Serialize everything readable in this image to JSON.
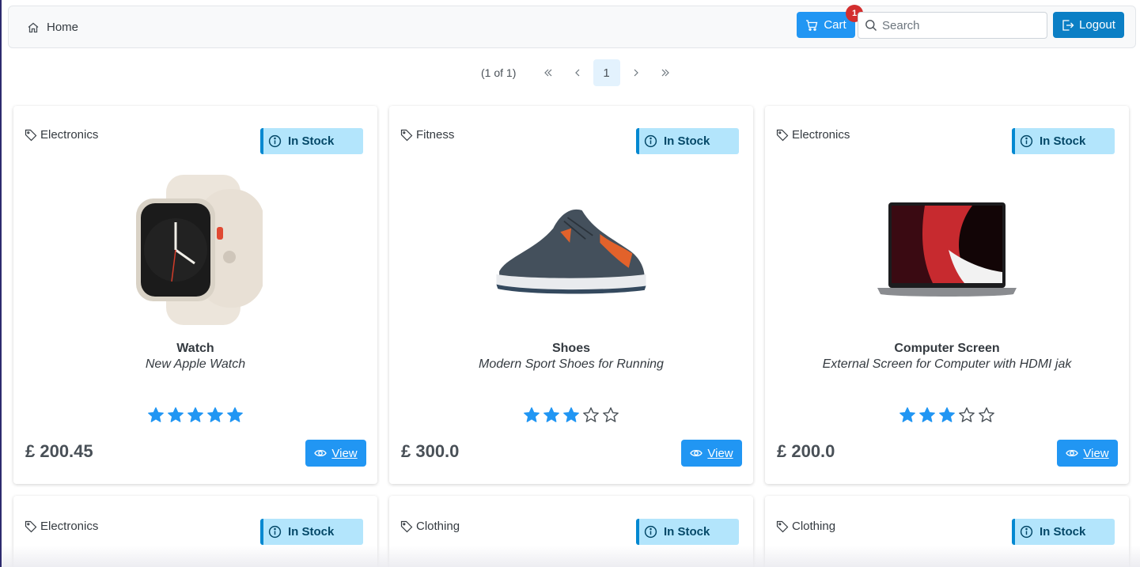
{
  "header": {
    "home_label": "Home",
    "cart_label": "Cart",
    "cart_count": "1",
    "search_placeholder": "Search",
    "logout_label": "Logout"
  },
  "paginator": {
    "report": "(1 of 1)",
    "current_page": "1"
  },
  "colors": {
    "primary": "#2196f3",
    "logout": "#0b7fc5",
    "badge_danger": "#d32f2f",
    "stock_bg": "#b3e5fc",
    "stock_border": "#0288d1",
    "star": "#2196f3"
  },
  "products": [
    {
      "category": "Electronics",
      "stock": "In Stock",
      "name": "Watch",
      "description": "New Apple Watch",
      "rating": 5,
      "price": "£ 200.45",
      "view_label": "View",
      "image_icon": "smartwatch-image"
    },
    {
      "category": "Fitness",
      "stock": "In Stock",
      "name": "Shoes",
      "description": "Modern Sport Shoes for Running",
      "rating": 3,
      "price": "£ 300.0",
      "view_label": "View",
      "image_icon": "sneaker-image"
    },
    {
      "category": "Electronics",
      "stock": "In Stock",
      "name": "Computer Screen",
      "description": "External Screen for Computer with HDMI jak",
      "rating": 3,
      "price": "£ 200.0",
      "view_label": "View",
      "image_icon": "laptop-image"
    },
    {
      "category": "Electronics",
      "stock": "In Stock"
    },
    {
      "category": "Clothing",
      "stock": "In Stock"
    },
    {
      "category": "Clothing",
      "stock": "In Stock"
    }
  ]
}
